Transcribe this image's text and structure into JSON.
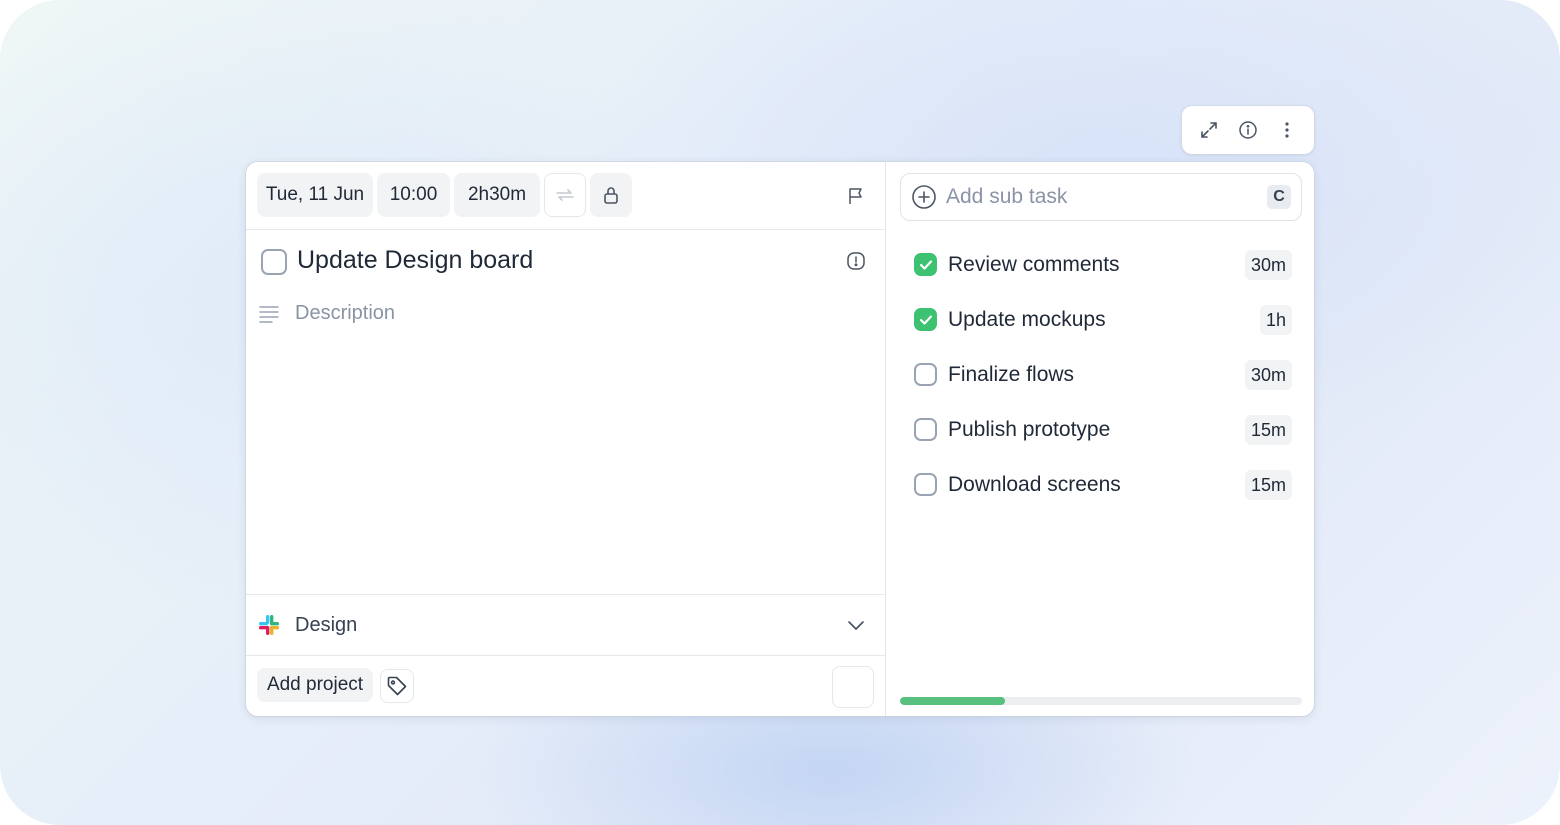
{
  "toolbar": {
    "icons": [
      "expand-icon",
      "info-icon",
      "more-vertical-icon"
    ]
  },
  "task": {
    "date": "Tue, 11 Jun",
    "time": "10:00",
    "duration": "2h30m",
    "title": "Update Design board",
    "description_placeholder": "Description",
    "completed": false
  },
  "project": {
    "name": "Design",
    "icon": "slack-icon"
  },
  "footer": {
    "add_project_label": "Add project"
  },
  "subtasks": {
    "add_placeholder": "Add sub task",
    "shortcut": "C",
    "items": [
      {
        "label": "Review comments",
        "duration": "30m",
        "done": true
      },
      {
        "label": "Update mockups",
        "duration": "1h",
        "done": true
      },
      {
        "label": "Finalize flows",
        "duration": "30m",
        "done": false
      },
      {
        "label": "Publish prototype",
        "duration": "15m",
        "done": false
      },
      {
        "label": "Download screens",
        "duration": "15m",
        "done": false
      }
    ],
    "progress_fraction": 0.26
  },
  "colors": {
    "accent_green": "#3cc271",
    "progress_green": "#57c07e"
  }
}
